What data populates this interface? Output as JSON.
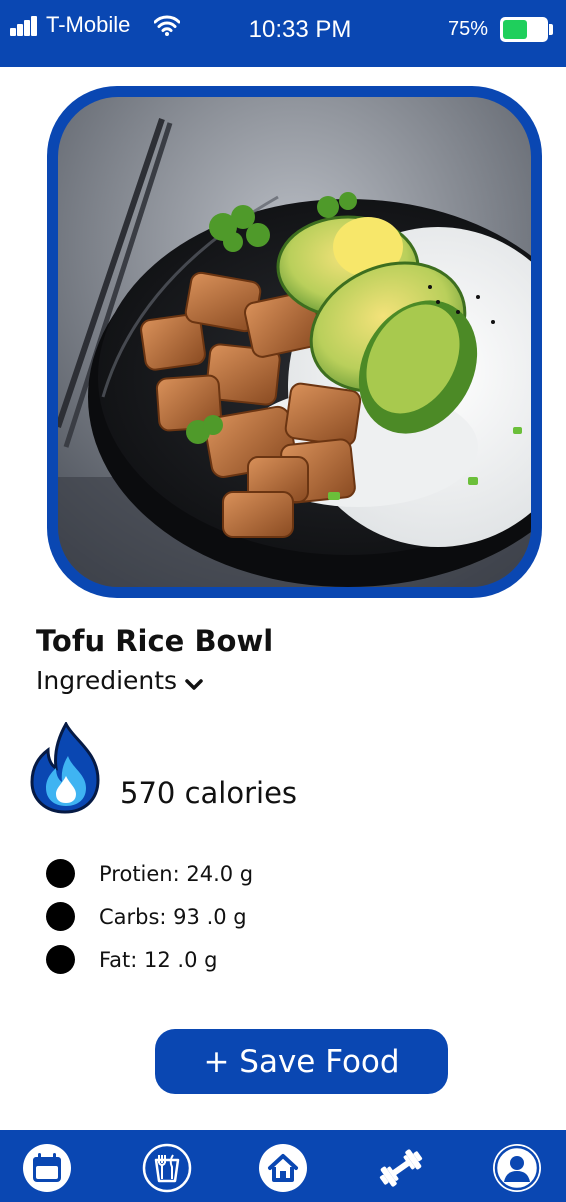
{
  "status_bar": {
    "carrier": "T-Mobile",
    "time": "10:33 PM",
    "battery_percent": "75%",
    "battery_level": 0.58,
    "battery_color": "#1fcf5c"
  },
  "theme": {
    "primary": "#0a47b2",
    "flame_outer": "#0a47b2",
    "flame_inner": "#3fb4f2"
  },
  "food": {
    "image_icon": "tofu-rice-bowl-photo",
    "title": "Tofu Rice Bowl",
    "ingredients_label": "Ingredients",
    "ingredients_icon": "chevron-down-icon",
    "calories_icon": "flame-icon",
    "calories": "570 calories",
    "macros": [
      {
        "text": "Protien:  24.0 g"
      },
      {
        "text": "Carbs: 93 .0 g"
      },
      {
        "text": "Fat: 12 .0 g"
      }
    ]
  },
  "actions": {
    "save_label": "+ Save Food"
  },
  "bottom_nav": {
    "items": [
      {
        "icon": "calendar-icon"
      },
      {
        "icon": "meal-icon"
      },
      {
        "icon": "home-icon"
      },
      {
        "icon": "dumbbell-icon"
      },
      {
        "icon": "profile-icon"
      }
    ]
  }
}
